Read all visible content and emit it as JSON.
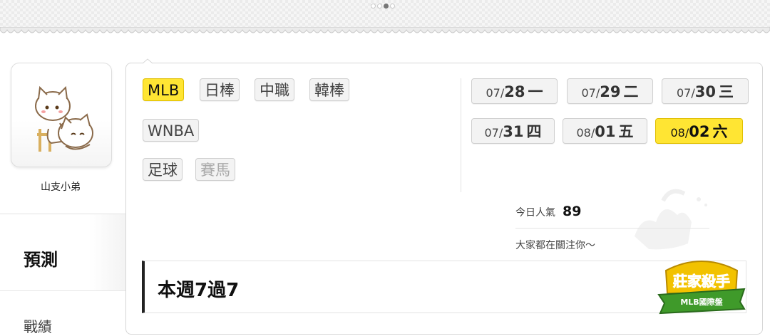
{
  "header": {
    "page_dots": 4,
    "active_dot": 2
  },
  "profile": {
    "username": "山支小弟"
  },
  "nav": {
    "items": [
      {
        "label": "預測"
      },
      {
        "label": "戰績"
      }
    ]
  },
  "leagues": [
    {
      "label": "MLB",
      "active": true
    },
    {
      "label": "日棒"
    },
    {
      "label": "中職"
    },
    {
      "label": "韓棒"
    },
    {
      "label": "WNBA"
    },
    {
      "label": "足球"
    },
    {
      "label": "賽馬",
      "disabled": true
    }
  ],
  "dates": [
    {
      "md": "07/",
      "day": "28",
      "weekday": "一"
    },
    {
      "md": "07/",
      "day": "29",
      "weekday": "二"
    },
    {
      "md": "07/",
      "day": "30",
      "weekday": "三"
    },
    {
      "md": "07/",
      "day": "31",
      "weekday": "四"
    },
    {
      "md": "08/",
      "day": "01",
      "weekday": "五"
    },
    {
      "md": "08/",
      "day": "02",
      "weekday": "六",
      "active": true
    }
  ],
  "stats": {
    "popularity_label": "今日人氣",
    "popularity_value": "89",
    "tagline": "大家都在關注你～"
  },
  "record": {
    "text": "本週7過7"
  },
  "badge": {
    "title": "莊家殺手",
    "subtitle": "MLB國際盤"
  },
  "colors": {
    "accent": "#ffe533",
    "accent_border": "#e0bf00",
    "badge_green": "#3f9a2a",
    "badge_gold": "#f2c200"
  }
}
